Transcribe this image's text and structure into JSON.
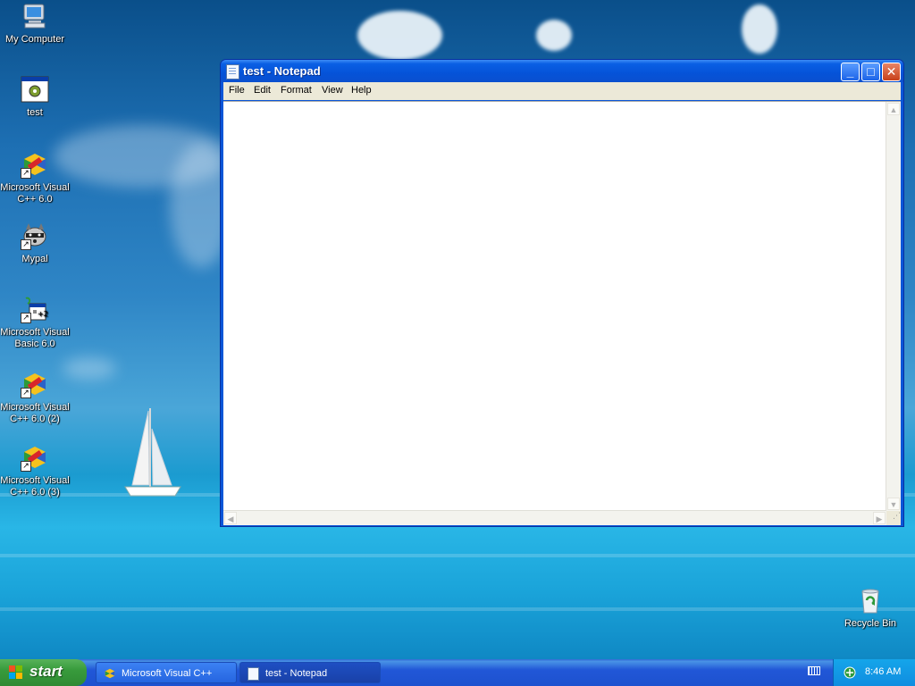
{
  "desktop": {
    "icons": [
      {
        "label": "My Computer",
        "icon": "my-computer-icon"
      },
      {
        "label": "test",
        "icon": "program-icon"
      },
      {
        "label": "Microsoft Visual C++ 6.0",
        "icon": "visual-cpp-icon"
      },
      {
        "label": "Mypal",
        "icon": "raccoon-icon"
      },
      {
        "label": "Microsoft Visual Basic 6.0",
        "icon": "visual-basic-icon"
      },
      {
        "label": "Microsoft Visual C++ 6.0 (2)",
        "icon": "visual-cpp-icon"
      },
      {
        "label": "Microsoft Visual C++ 6.0 (3)",
        "icon": "visual-cpp-icon"
      }
    ],
    "recycle_bin": {
      "label": "Recycle Bin",
      "icon": "recycle-bin-icon"
    }
  },
  "notepad": {
    "title": "test - Notepad",
    "menu": [
      "File",
      "Edit",
      "Format",
      "View",
      "Help"
    ],
    "content": "",
    "controls": {
      "minimize": "_",
      "maximize": "□",
      "close": "✕"
    }
  },
  "taskbar": {
    "start_label": "start",
    "tasks": [
      {
        "label": "Microsoft Visual C++",
        "active": false
      },
      {
        "label": "test - Notepad",
        "active": true
      }
    ],
    "clock": "8:46 AM"
  },
  "colors": {
    "titlebar": "#0553d8",
    "taskbar": "#2157d7",
    "start_button": "#389b3c",
    "tray": "#0f8de0",
    "menu_bg": "#ece9d8"
  }
}
